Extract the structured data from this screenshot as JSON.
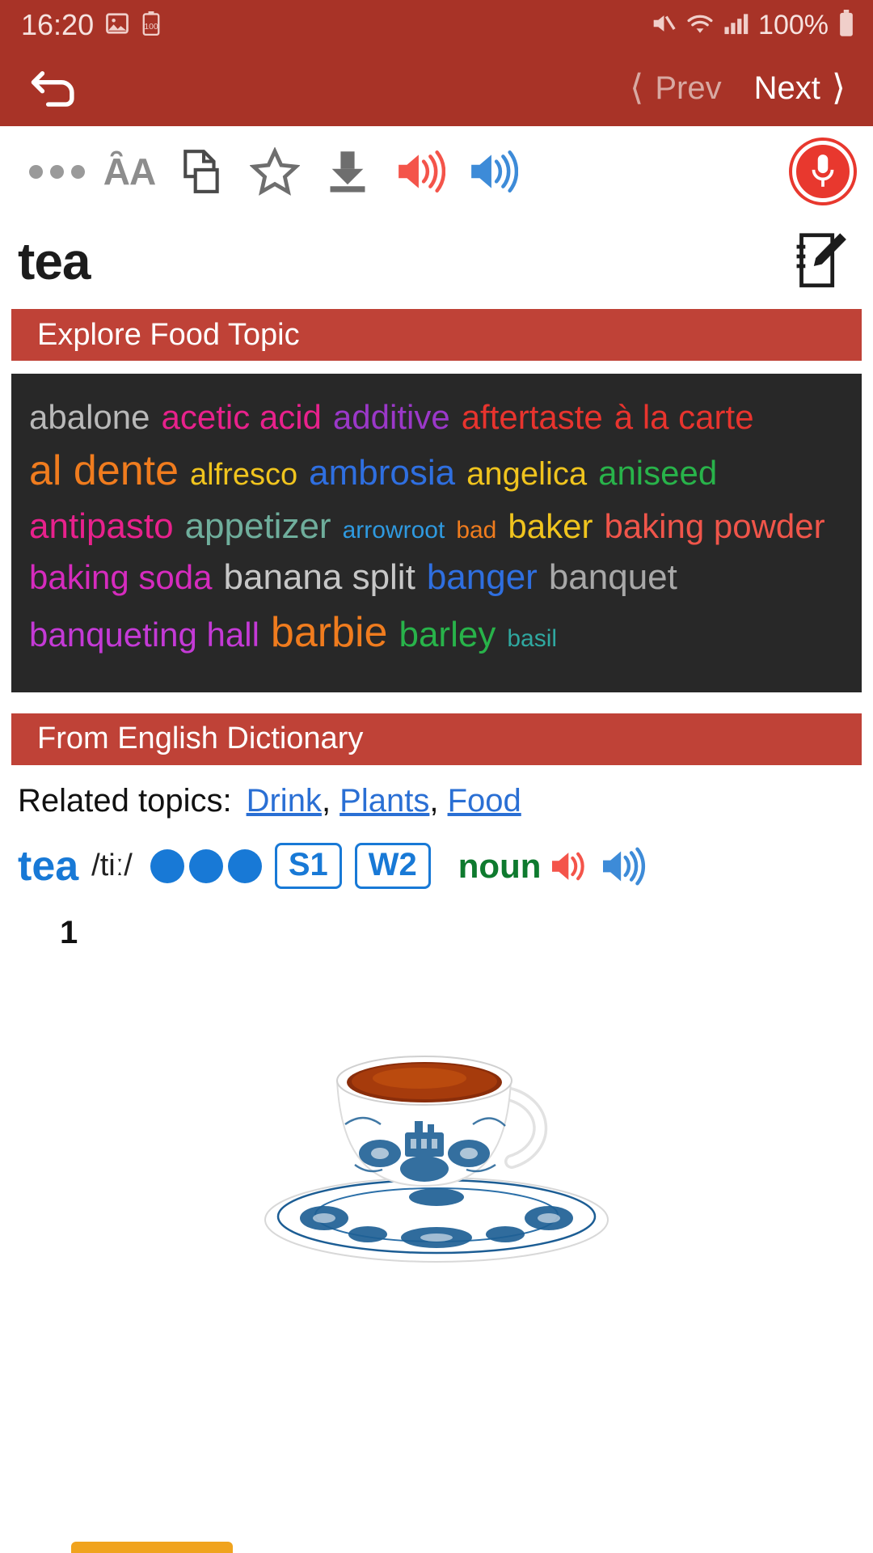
{
  "status_bar": {
    "time": "16:20",
    "battery_percent": "100%",
    "icons": [
      "image-icon",
      "battery-saver-icon",
      "mute-icon",
      "wifi-icon",
      "cell-signal-icon",
      "battery-icon"
    ],
    "background": "#a83327"
  },
  "nav_bar": {
    "back_icon": "back-arrow-icon",
    "prev_label": "Prev",
    "next_label": "Next",
    "prev_enabled": false,
    "next_enabled": true
  },
  "toolbar": {
    "items": [
      {
        "name": "more-options-icon",
        "label": "More"
      },
      {
        "name": "font-size-icon",
        "label": "AA"
      },
      {
        "name": "copy-icon",
        "label": "Copy"
      },
      {
        "name": "favorite-star-icon",
        "label": "Favorite"
      },
      {
        "name": "download-icon",
        "label": "Download"
      },
      {
        "name": "speaker-us-icon",
        "label": "US audio",
        "color": "#f4544a"
      },
      {
        "name": "speaker-uk-icon",
        "label": "UK audio",
        "color": "#3d8bd8"
      }
    ],
    "mic_button": {
      "name": "microphone-button",
      "color": "#e8382e"
    }
  },
  "headword": {
    "text": "tea",
    "edit_icon": "note-edit-icon"
  },
  "sections": {
    "topic_bar": "Explore Food Topic",
    "dictionary_bar": "From English Dictionary"
  },
  "word_cloud": {
    "background": "#282828",
    "rows": [
      [
        {
          "text": "abalone",
          "color": "#b9b9b9",
          "size": 42
        },
        {
          "text": "acetic acid",
          "color": "#e8218c",
          "size": 42
        },
        {
          "text": "additive",
          "color": "#9b38c9",
          "size": 42
        },
        {
          "text": "aftertaste",
          "color": "#e8342e",
          "size": 42
        },
        {
          "text": "à la carte",
          "color": "#e8342e",
          "size": 42
        }
      ],
      [
        {
          "text": "al dente",
          "color": "#f07c1e",
          "size": 52
        },
        {
          "text": "alfresco",
          "color": "#f0c41e",
          "size": 38
        },
        {
          "text": "ambrosia",
          "color": "#2f6fe0",
          "size": 44
        },
        {
          "text": "angelica",
          "color": "#f0c41e",
          "size": 40
        },
        {
          "text": "aniseed",
          "color": "#28b34a",
          "size": 42
        }
      ],
      [
        {
          "text": "antipasto",
          "color": "#e8218c",
          "size": 44
        },
        {
          "text": "appetizer",
          "color": "#6fae9c",
          "size": 44
        },
        {
          "text": "arrowroot",
          "color": "#2f9ae0",
          "size": 30
        },
        {
          "text": "bad",
          "color": "#f07c1e",
          "size": 30
        },
        {
          "text": "baker",
          "color": "#f0c41e",
          "size": 42
        },
        {
          "text": "baking powder",
          "color": "#f0554a",
          "size": 42
        }
      ],
      [
        {
          "text": "baking soda",
          "color": "#d62bbe",
          "size": 42
        },
        {
          "text": "banana split",
          "color": "#c7c7c7",
          "size": 44
        },
        {
          "text": "banger",
          "color": "#2f6fe0",
          "size": 44
        },
        {
          "text": "banquet",
          "color": "#a8a8a8",
          "size": 44
        }
      ],
      [
        {
          "text": "banqueting hall",
          "color": "#c43ad6",
          "size": 42
        },
        {
          "text": "barbie",
          "color": "#f07c1e",
          "size": 52
        },
        {
          "text": "barley",
          "color": "#28b34a",
          "size": 44
        },
        {
          "text": "basil",
          "color": "#2fa8a0",
          "size": 30
        }
      ]
    ]
  },
  "entry": {
    "related_topics_label": "Related topics:",
    "related_topics": [
      "Drink",
      "Plants",
      "Food"
    ],
    "word": "tea",
    "pronunciation": "/tiː/",
    "frequency_dots": 3,
    "badges": [
      "S1",
      "W2"
    ],
    "part_of_speech": "noun",
    "audio_icons": [
      "speaker-us-icon",
      "speaker-uk-icon"
    ],
    "sense_number": "1",
    "illustration": "teacup-and-saucer-image"
  }
}
